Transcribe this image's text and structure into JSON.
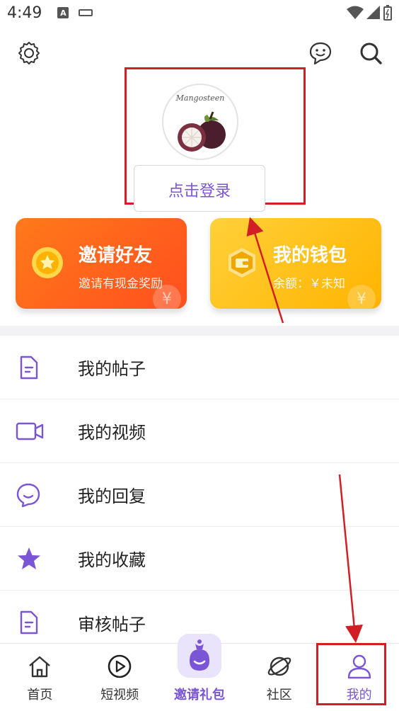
{
  "status": {
    "time": "4:49",
    "a_icon": "A"
  },
  "header": {
    "settings_icon": "gear-icon",
    "chat_icon": "chat-face-icon",
    "search_icon": "search-icon"
  },
  "login": {
    "avatar_word": "Mangosteen",
    "button": "点击登录"
  },
  "cards": {
    "invite": {
      "title": "邀请好友",
      "sub": "邀请有现金奖励",
      "icon": "coin-star-icon"
    },
    "wallet": {
      "title": "我的钱包",
      "sub": "余额：￥未知",
      "icon": "wallet-icon"
    },
    "deco_symbol": "¥"
  },
  "menu": [
    {
      "label": "我的帖子",
      "icon": "document-icon"
    },
    {
      "label": "我的视频",
      "icon": "video-camera-icon"
    },
    {
      "label": "我的回复",
      "icon": "reply-bubble-icon"
    },
    {
      "label": "我的收藏",
      "icon": "star-icon"
    },
    {
      "label": "审核帖子",
      "icon": "review-document-icon"
    }
  ],
  "nav": [
    {
      "label": "首页",
      "icon": "home-icon"
    },
    {
      "label": "短视频",
      "icon": "play-circle-icon"
    },
    {
      "label": "邀请礼包",
      "icon": "gift-bag-icon"
    },
    {
      "label": "社区",
      "icon": "planet-icon"
    },
    {
      "label": "我的",
      "icon": "person-icon"
    }
  ],
  "colors": {
    "accent": "#7a55d6",
    "invite": "#ff5a1f",
    "wallet": "#ffbf1a",
    "annotation": "#d21f26"
  }
}
